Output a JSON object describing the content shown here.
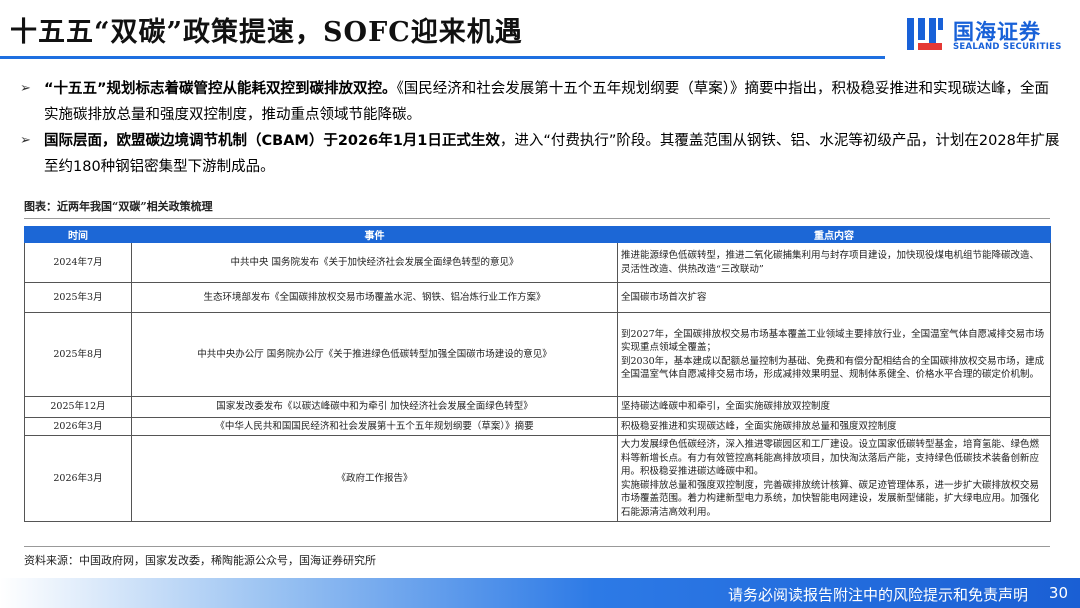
{
  "header": {
    "title": "十五五“双碳”政策提速，SOFC迎来机遇",
    "logo_cn": "国海证券",
    "logo_en": "SEALAND SECURITIES",
    "accent_color": "#1e6fe0"
  },
  "bullets": [
    {
      "marker": "➢",
      "strong": "“十五五”规划标志着碳管控从能耗双控到碳排放双控。",
      "text": "《国民经济和社会发展第十五个五年规划纲要（草案）》摘要中指出，积极稳妥推进和实现碳达峰，全面实施碳排放总量和强度双控制度，推动重点领域节能降碳。"
    },
    {
      "marker": "➢",
      "strong": "国际层面，欧盟碳边境调节机制（CBAM）于2026年1月1日正式生效",
      "text": "，进入“付费执行”阶段。其覆盖范围从钢铁、铝、水泥等初级产品，计划在2028年扩展至约180种钢铝密集型下游制成品。"
    }
  ],
  "figure": {
    "caption": "图表：近两年我国“双碳”相关政策梳理",
    "headers": {
      "time": "时间",
      "event": "事件",
      "content": "重点内容"
    },
    "rows": [
      {
        "time": "2024年7月",
        "event": "中共中央 国务院发布《关于加快经济社会发展全面绿色转型的意见》",
        "content": "推进能源绿色低碳转型，推进二氧化碳捕集利用与封存项目建设，加快现役煤电机组节能降碳改造、灵活性改造、供热改造“三改联动”"
      },
      {
        "time": "2025年3月",
        "event": "生态环境部发布《全国碳排放权交易市场覆盖水泥、钢铁、铝冶炼行业工作方案》",
        "content": "全国碳市场首次扩容"
      },
      {
        "time": "2025年8月",
        "event": "中共中央办公厅 国务院办公厅《关于推进绿色低碳转型加强全国碳市场建设的意见》",
        "content": "到2027年，全国碳排放权交易市场基本覆盖工业领域主要排放行业，全国温室气体自愿减排交易市场实现重点领域全覆盖；\n到2030年，基本建成以配额总量控制为基础、免费和有偿分配相结合的全国碳排放权交易市场，建成全国温室气体自愿减排交易市场，形成减排效果明显、规制体系健全、价格水平合理的碳定价机制。"
      },
      {
        "time": "2025年12月",
        "event": "国家发改委发布《以碳达峰碳中和为牵引 加快经济社会发展全面绿色转型》",
        "content": "坚持碳达峰碳中和牵引，全面实施碳排放双控制度"
      },
      {
        "time": "2026年3月",
        "event": "《中华人民共和国国民经济和社会发展第十五个五年规划纲要（草案）》摘要",
        "content": "积极稳妥推进和实现碳达峰，全面实施碳排放总量和强度双控制度"
      },
      {
        "time": "2026年3月",
        "event": "《政府工作报告》",
        "content": "大力发展绿色低碳经济，深入推进零碳园区和工厂建设。设立国家低碳转型基金，培育氢能、绿色燃料等新增长点。有力有效管控高耗能高排放项目，加快淘汰落后产能，支持绿色低碳技术装备创新应用。积极稳妥推进碳达峰碳中和。\n实施碳排放总量和强度双控制度，完善碳排放统计核算、碳足迹管理体系，进一步扩大碳排放权交易市场覆盖范围。着力构建新型电力系统，加快智能电网建设，发展新型储能，扩大绿电应用。加强化石能源清洁高效利用。"
      }
    ],
    "source": "资料来源：中国政府网，国家发改委，稀陶能源公众号，国海证券研究所"
  },
  "footer": {
    "disclaimer": "请务必阅读报告附注中的风险提示和免责声明",
    "page": "30"
  }
}
